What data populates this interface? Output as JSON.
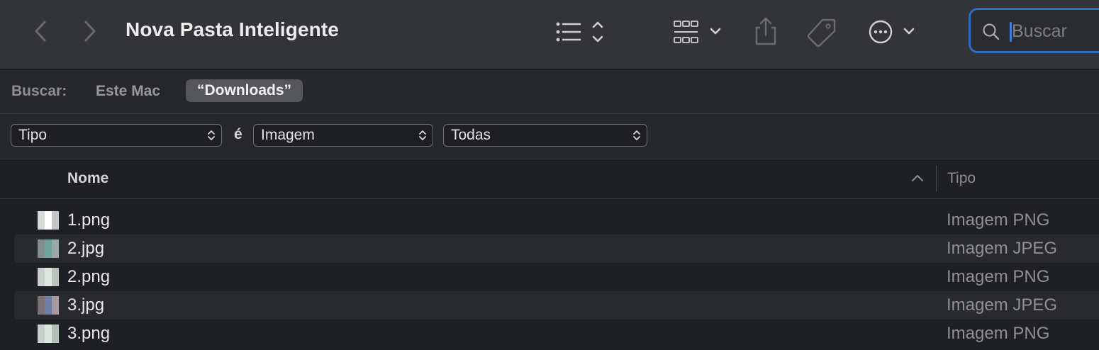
{
  "window": {
    "title": "Nova Pasta Inteligente"
  },
  "search": {
    "placeholder": "Buscar"
  },
  "scope": {
    "label": "Buscar:",
    "options": [
      "Este Mac",
      "“Downloads”"
    ],
    "selected": "“Downloads”"
  },
  "criteria": {
    "attribute": "Tipo",
    "conjunction": "é",
    "value": "Imagem",
    "subvalue": "Todas"
  },
  "columns": {
    "name": "Nome",
    "type": "Tipo"
  },
  "files": [
    {
      "name": "1.png",
      "type": "Imagem PNG",
      "thumb": [
        "#d8dcd8",
        "#ffffff",
        "#c4c8c4"
      ]
    },
    {
      "name": "2.jpg",
      "type": "Imagem JPEG",
      "thumb": [
        "#7e8f8c",
        "#6fa3a0",
        "#9aa7a4"
      ]
    },
    {
      "name": "2.png",
      "type": "Imagem PNG",
      "thumb": [
        "#c9d3cc",
        "#dfe6e0",
        "#b8c2bb"
      ]
    },
    {
      "name": "3.jpg",
      "type": "Imagem JPEG",
      "thumb": [
        "#7f7276",
        "#6d7fa6",
        "#a99aa0"
      ]
    },
    {
      "name": "3.png",
      "type": "Imagem PNG",
      "thumb": [
        "#c6d1ca",
        "#dde5df",
        "#b3beb7"
      ]
    }
  ],
  "colors": {
    "accent": "#2e6dbd",
    "toolbar": "#333437",
    "background": "#1f2023"
  }
}
